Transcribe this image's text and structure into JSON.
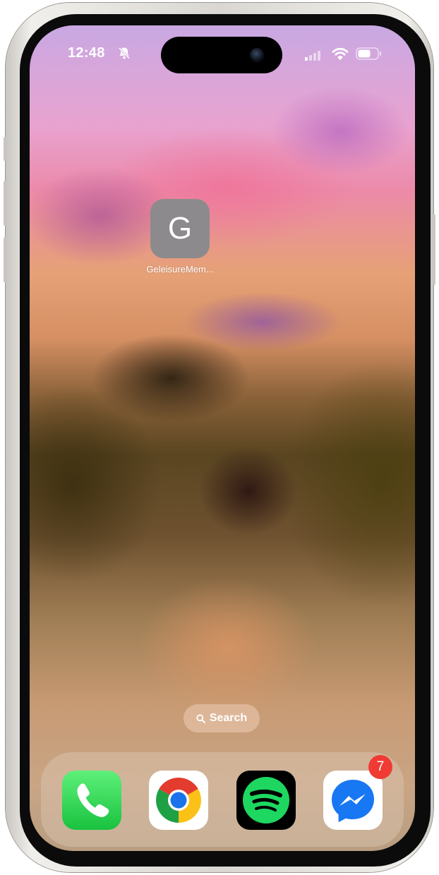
{
  "status_bar": {
    "time": "12:48",
    "icons": [
      "bell-slash-icon",
      "signal-icon",
      "wifi-icon",
      "battery-icon"
    ]
  },
  "home": {
    "apps": [
      {
        "letter": "G",
        "label": "GeleisureMem..."
      }
    ]
  },
  "search": {
    "label": "Search",
    "icon": "search-icon"
  },
  "dock": {
    "apps": [
      {
        "name": "Phone",
        "icon": "phone-icon"
      },
      {
        "name": "Chrome",
        "icon": "chrome-icon"
      },
      {
        "name": "Spotify",
        "icon": "spotify-icon"
      },
      {
        "name": "Messenger",
        "icon": "messenger-icon",
        "badge": "7"
      }
    ]
  },
  "colors": {
    "badge": "#ef3b34",
    "phone_green": "#19c23f",
    "spotify_green": "#1ed760",
    "messenger_blue": "#1877f2",
    "placeholder_icon_gray": "#8c8a8c"
  }
}
